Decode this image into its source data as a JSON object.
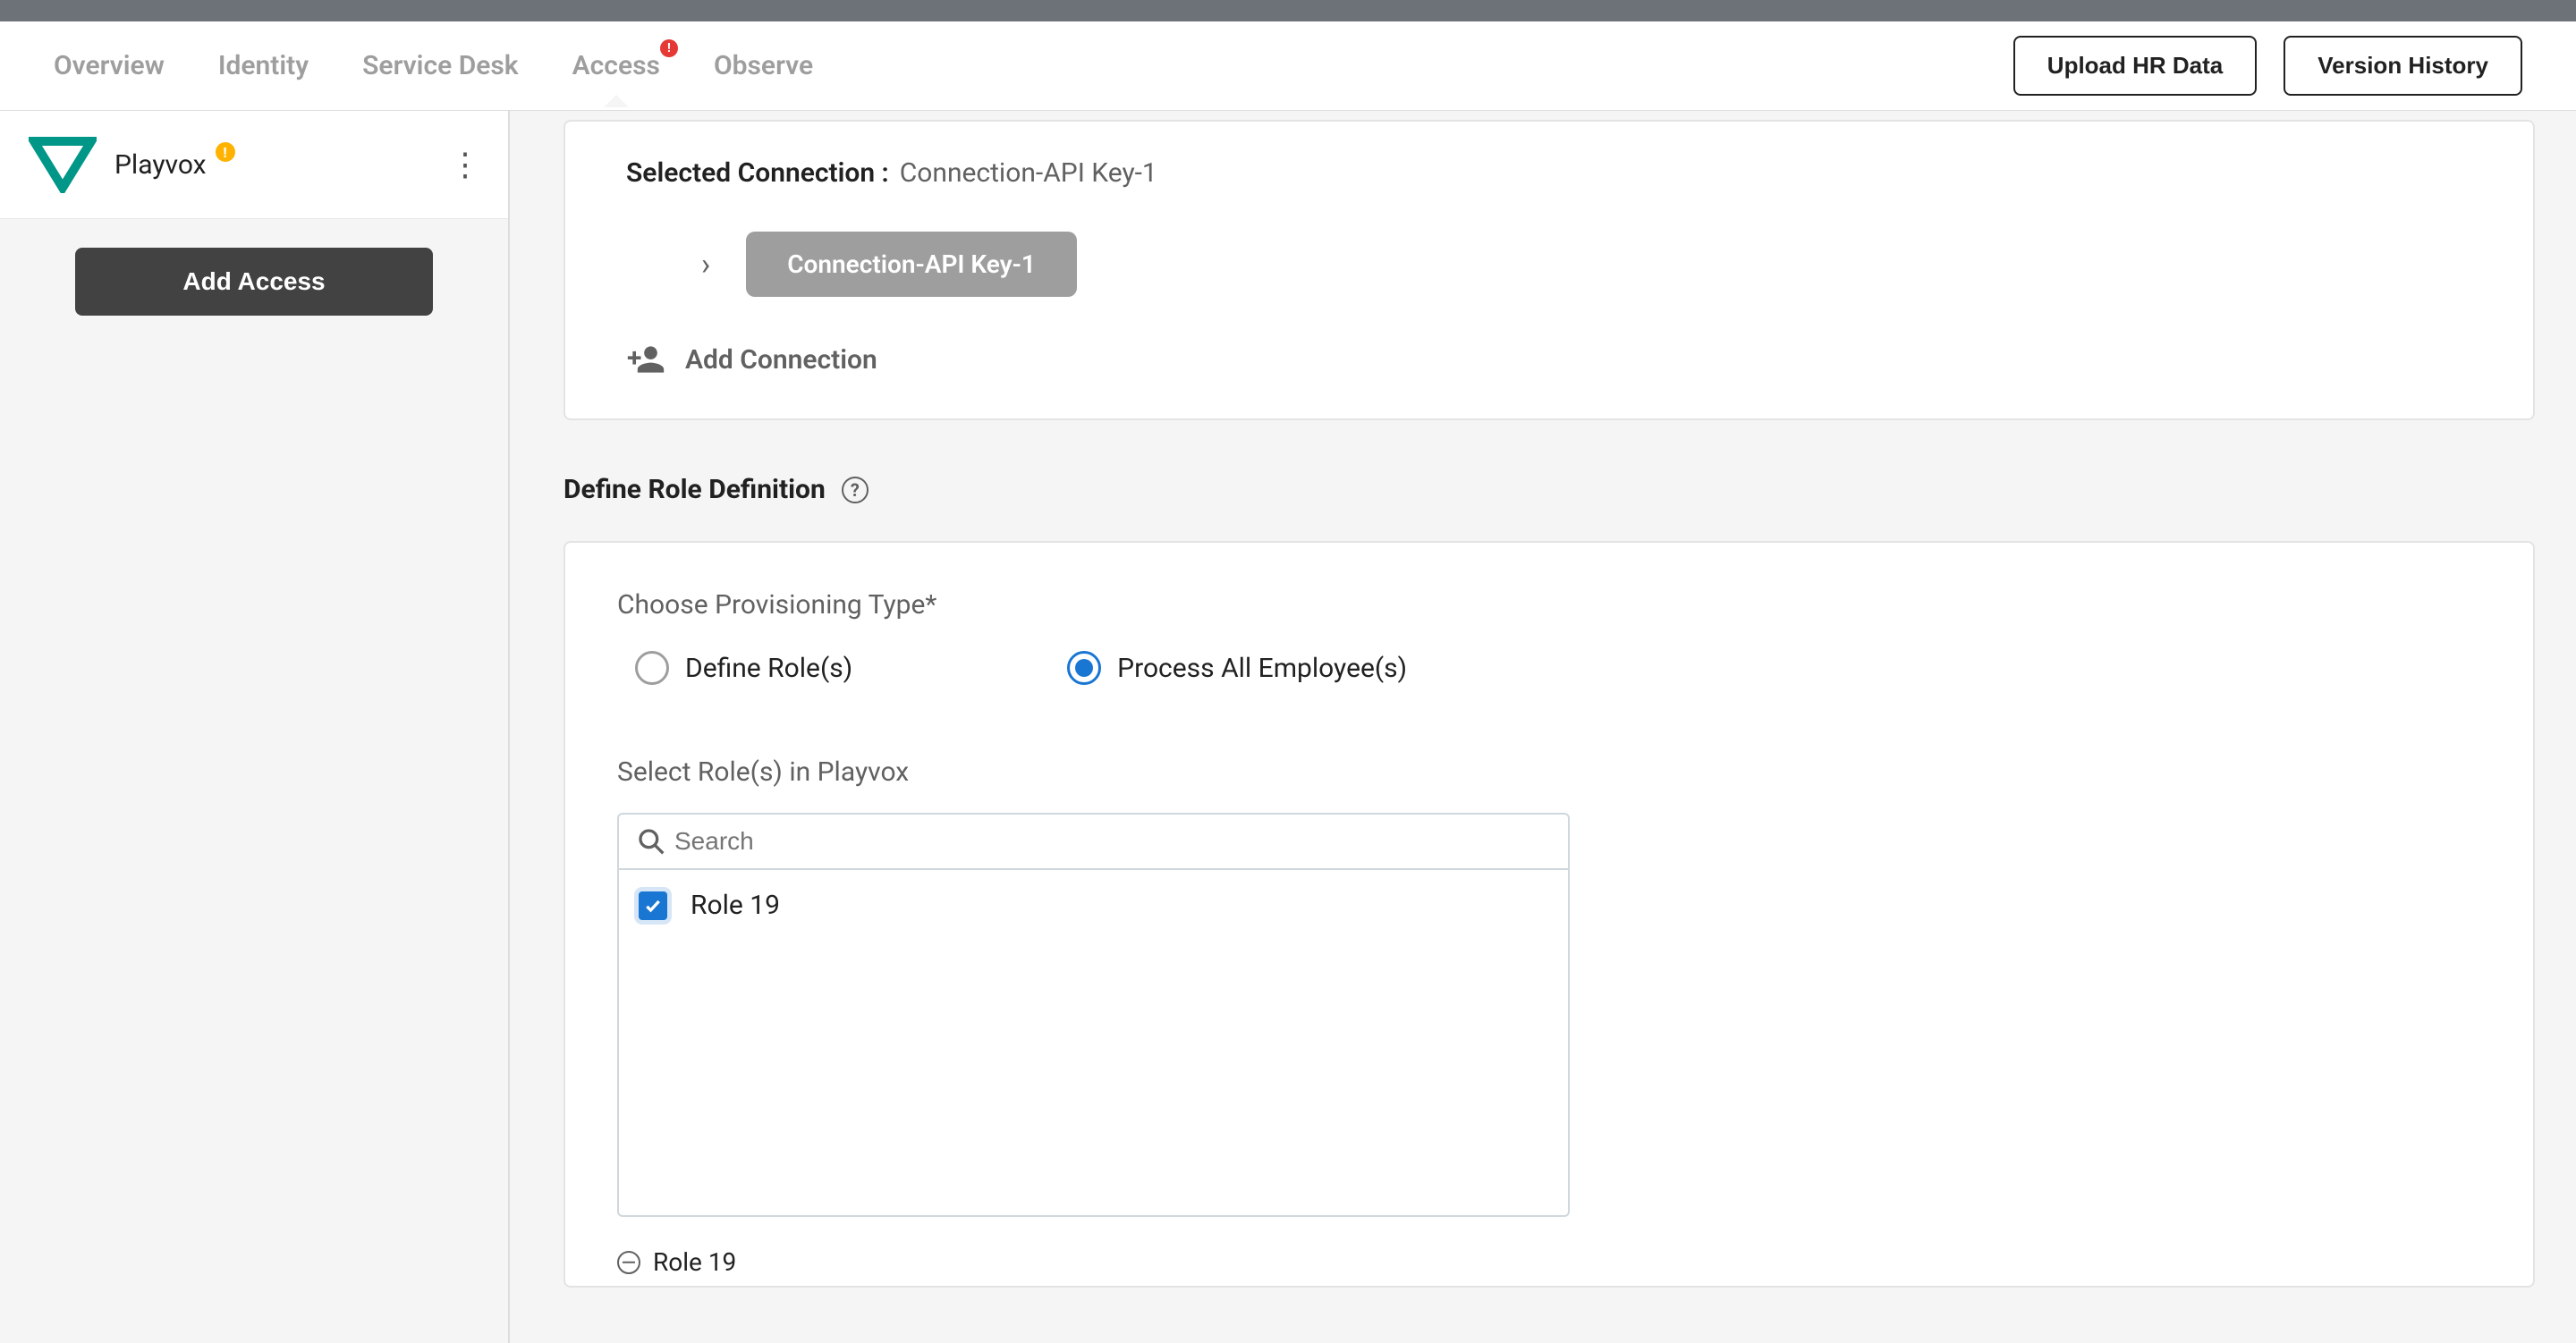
{
  "nav": {
    "tabs": [
      {
        "label": "Overview",
        "active": false
      },
      {
        "label": "Identity",
        "active": false
      },
      {
        "label": "Service Desk",
        "active": false
      },
      {
        "label": "Access",
        "active": true,
        "alert": "!"
      },
      {
        "label": "Observe",
        "active": false
      }
    ],
    "upload_btn": "Upload HR Data",
    "version_btn": "Version History"
  },
  "sidebar": {
    "items": [
      {
        "name": "Playvox",
        "warn": "!",
        "logo_color": "#009688"
      }
    ],
    "add_access": "Add Access"
  },
  "connection": {
    "label": "Selected Connection :",
    "value": "Connection-API Key-1",
    "chip": "Connection-API Key-1",
    "add_label": "Add Connection"
  },
  "role_def": {
    "title": "Define Role Definition",
    "provisioning_label": "Choose Provisioning Type*",
    "options": {
      "define": "Define Role(s)",
      "process_all": "Process All Employee(s)"
    },
    "selected_option": "process_all",
    "select_label": "Select Role(s) in Playvox",
    "search_placeholder": "Search",
    "roles": [
      {
        "label": "Role 19",
        "checked": true
      }
    ],
    "selected_chips": [
      "Role 19"
    ]
  }
}
